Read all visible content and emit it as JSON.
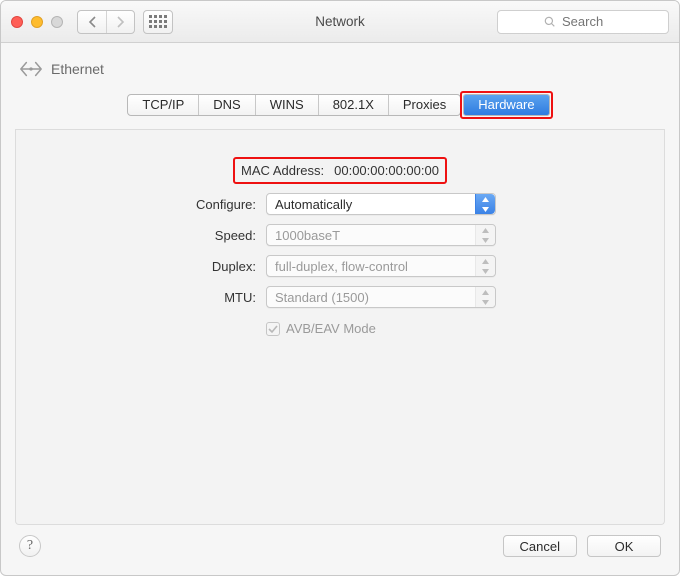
{
  "window": {
    "title": "Network",
    "search_placeholder": "Search"
  },
  "panel": {
    "title": "Ethernet"
  },
  "tabs": [
    {
      "label": "TCP/IP",
      "active": false
    },
    {
      "label": "DNS",
      "active": false
    },
    {
      "label": "WINS",
      "active": false
    },
    {
      "label": "802.1X",
      "active": false
    },
    {
      "label": "Proxies",
      "active": false
    },
    {
      "label": "Hardware",
      "active": true
    }
  ],
  "hardware": {
    "mac_label": "MAC Address:",
    "mac_value": "00:00:00:00:00:00",
    "configure_label": "Configure:",
    "configure_value": "Automatically",
    "speed_label": "Speed:",
    "speed_value": "1000baseT",
    "duplex_label": "Duplex:",
    "duplex_value": "full-duplex, flow-control",
    "mtu_label": "MTU:",
    "mtu_value": "Standard  (1500)",
    "avb_label": "AVB/EAV Mode",
    "avb_checked": true
  },
  "footer": {
    "cancel": "Cancel",
    "ok": "OK"
  }
}
